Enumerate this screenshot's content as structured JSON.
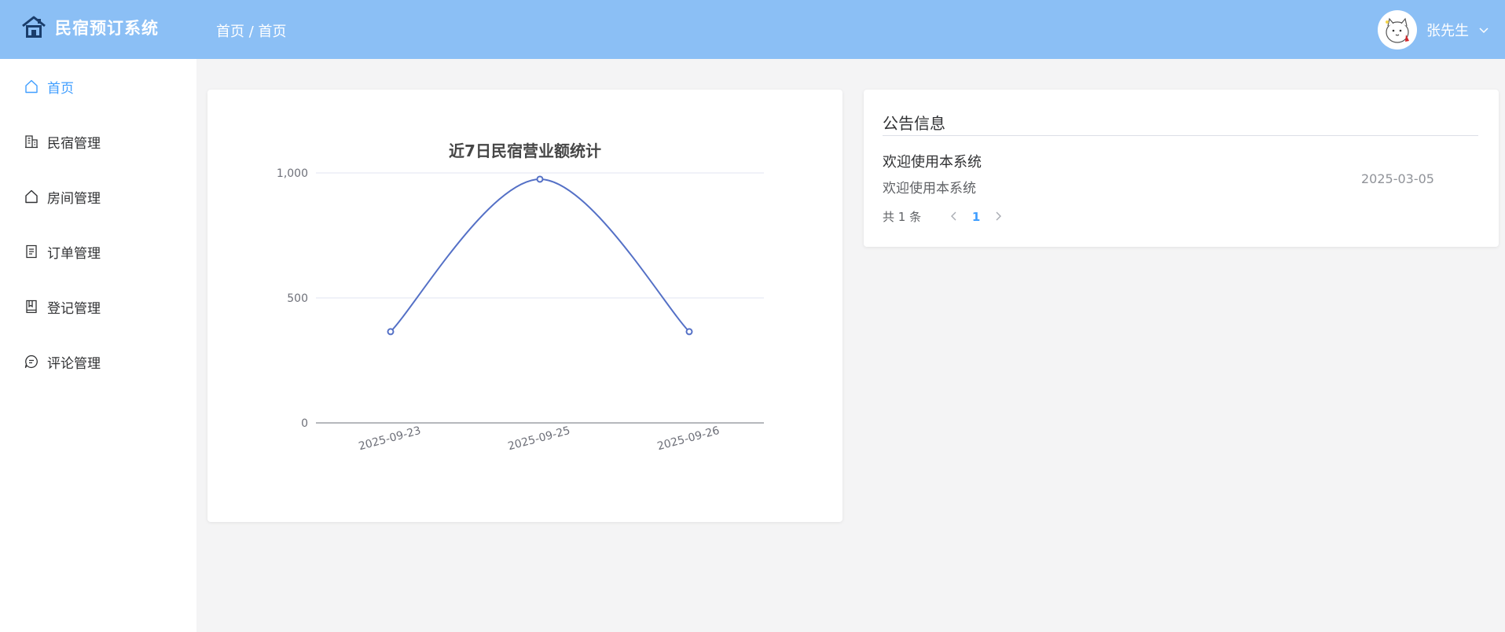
{
  "app": {
    "title": "民宿预订系统"
  },
  "header": {
    "breadcrumb": "首页 / 首页",
    "username": "张先生"
  },
  "sidebar": {
    "items": [
      {
        "label": "首页",
        "icon": "home-icon",
        "active": true
      },
      {
        "label": "民宿管理",
        "icon": "building-icon"
      },
      {
        "label": "房间管理",
        "icon": "house-icon"
      },
      {
        "label": "订单管理",
        "icon": "document-icon"
      },
      {
        "label": "登记管理",
        "icon": "book-icon"
      },
      {
        "label": "评论管理",
        "icon": "chat-icon"
      }
    ]
  },
  "colors": {
    "header": "#8bbff5",
    "accent": "#409eff",
    "line": "#5470c6",
    "page_bg": "#f4f4f5"
  },
  "chart_data": {
    "type": "line",
    "title": "近7日民宿营业额统计",
    "categories": [
      "2025-09-23",
      "2025-09-25",
      "2025-09-26"
    ],
    "series": [
      {
        "values": [
          365,
          975,
          365
        ]
      }
    ],
    "ylim": [
      0,
      1000
    ],
    "yticks": [
      "0",
      "500",
      "1,000"
    ],
    "smooth": true,
    "grid": true
  },
  "notice": {
    "title": "公告信息",
    "items": [
      {
        "title": "欢迎使用本系统",
        "content": "欢迎使用本系统",
        "date": "2025-03-05"
      }
    ],
    "total": "共 1 条",
    "current_page": "1"
  }
}
